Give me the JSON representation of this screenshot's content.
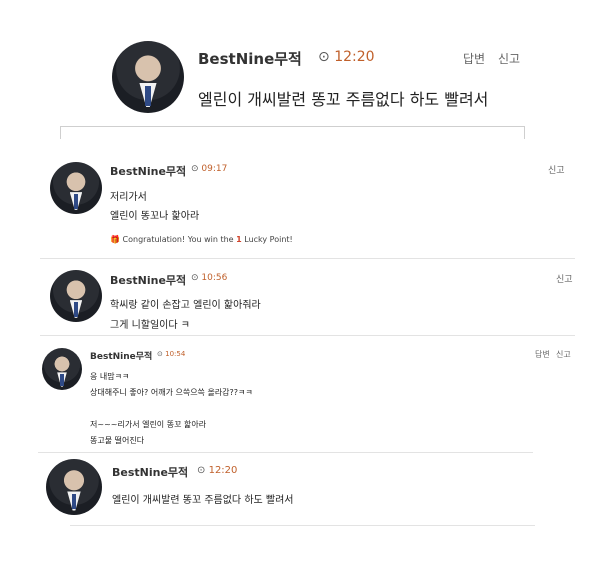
{
  "top_post": {
    "author": "BestNine무적",
    "time": "12:20",
    "reply": "답변",
    "report": "신고",
    "text": "엘린이 개씨발련 똥꼬 주름없다 하도 빨려서"
  },
  "comments": [
    {
      "author": "BestNine무적",
      "time": "09:17",
      "report": "신고",
      "lines": [
        "저리가서",
        "엘린이 똥꼬나 핥아라"
      ],
      "lucky_prefix": "Congratulation! You win the",
      "lucky_count": "1",
      "lucky_suffix": "Lucky Point!"
    },
    {
      "author": "BestNine무적",
      "time": "10:56",
      "report": "신고",
      "lines": [
        "학씨랑 같이 손잡고 엘린이 핥아줘라",
        "그게 니할일이다 ㅋ"
      ]
    },
    {
      "author": "BestNine무적",
      "time": "10:54",
      "reply": "답변",
      "report": "신고",
      "lines": [
        "응 내맘ㅋㅋ",
        "상대해주니 좋아?  어깨가 으쓱으쓱 올라감??ㅋㅋ",
        "저~~~리가서 엘린이 똥꼬 핥아라",
        "똥고물 떨어진다"
      ]
    },
    {
      "author": "BestNine무적",
      "time": "12:20",
      "lines": [
        "엘린이 개씨발련 똥꼬 주름없다 하도 빨려서"
      ]
    }
  ]
}
